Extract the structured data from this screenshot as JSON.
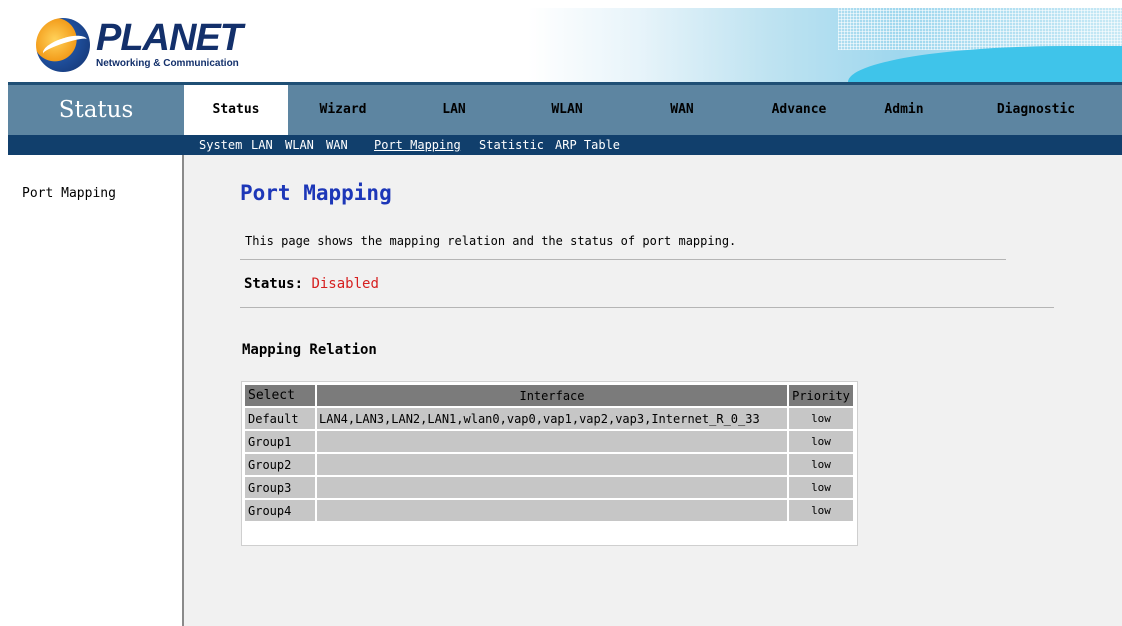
{
  "brand": {
    "name": "PLANET",
    "tagline": "Networking & Communication"
  },
  "nav": {
    "section_title": "Status",
    "tabs": [
      {
        "label": "Status",
        "active": true
      },
      {
        "label": "Wizard",
        "active": false
      },
      {
        "label": "LAN",
        "active": false
      },
      {
        "label": "WLAN",
        "active": false
      },
      {
        "label": "WAN",
        "active": false
      },
      {
        "label": "Advance",
        "active": false
      },
      {
        "label": "Admin",
        "active": false
      },
      {
        "label": "Diagnostic",
        "active": false
      }
    ]
  },
  "subnav": {
    "items": [
      "System",
      "LAN",
      "WLAN",
      "WAN",
      "Port Mapping",
      "Statistic",
      "ARP Table"
    ],
    "current": "Port Mapping"
  },
  "sidebar": {
    "items": [
      "Port Mapping"
    ]
  },
  "page": {
    "title": "Port Mapping",
    "description": "This page shows the mapping relation and the status of port mapping.",
    "status_label": "Status:",
    "status_value": "Disabled",
    "section_title": "Mapping Relation"
  },
  "table": {
    "headers": {
      "select": "Select",
      "interface": "Interface",
      "priority": "Priority"
    },
    "rows": [
      {
        "select": "Default",
        "interface": "LAN4,LAN3,LAN2,LAN1,wlan0,vap0,vap1,vap2,vap3,Internet_R_0_33",
        "priority": "low"
      },
      {
        "select": "Group1",
        "interface": "",
        "priority": "low"
      },
      {
        "select": "Group2",
        "interface": "",
        "priority": "low"
      },
      {
        "select": "Group3",
        "interface": "",
        "priority": "low"
      },
      {
        "select": "Group4",
        "interface": "",
        "priority": "low"
      }
    ]
  },
  "colors": {
    "nav_bar": "#5d85a1",
    "subnav_bar": "#113f6c",
    "title_blue": "#1d37b8",
    "status_red": "#d61f1f"
  }
}
